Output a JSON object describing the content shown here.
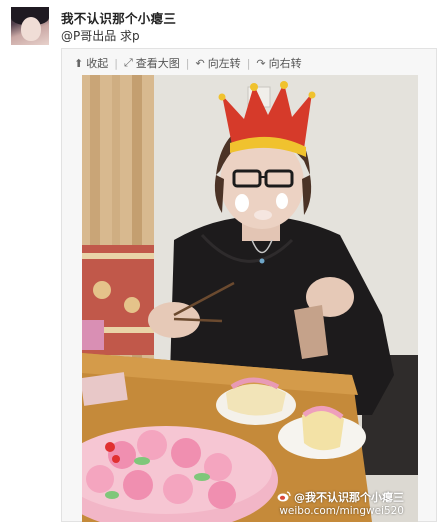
{
  "post": {
    "username": "我不认识那个小瘪三",
    "text": "@P哥出品 求p"
  },
  "toolbar": {
    "items": [
      {
        "icon": "collapse-up-icon",
        "glyph": "⬆",
        "label": "收起"
      },
      {
        "icon": "enlarge-image-icon",
        "glyph": "⤢",
        "label": "查看大图"
      },
      {
        "icon": "rotate-left-icon",
        "glyph": "↶",
        "label": "向左转"
      },
      {
        "icon": "rotate-right-icon",
        "glyph": "↷",
        "label": "向右转"
      }
    ]
  },
  "photo": {
    "watermark_name": "@我不认识那个小瘪三",
    "watermark_url": "weibo.com/mingwei520"
  },
  "colors": {
    "accent_link": "#333333",
    "border": "#e2e2e2"
  }
}
